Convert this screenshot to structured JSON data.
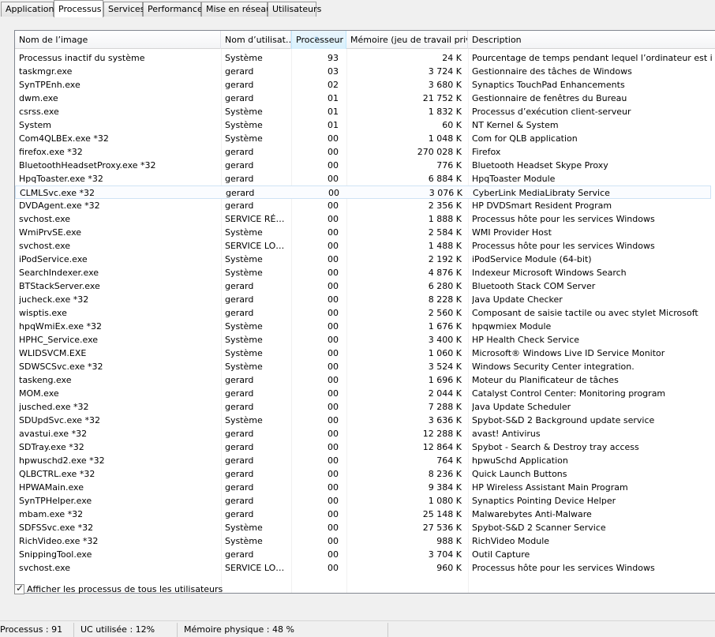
{
  "tabs": [
    "Applications",
    "Processus",
    "Services",
    "Performance",
    "Mise en réseau",
    "Utilisateurs"
  ],
  "active_tab": "Processus",
  "columns": [
    "Nom de l’image",
    "Nom d’utilisat…",
    "Processeur",
    "Mémoire (jeu de travail privé)",
    "Description"
  ],
  "sorted_column": "Processeur",
  "processes": [
    [
      "Processus inactif du système",
      "Système",
      "93",
      "24 K",
      "Pourcentage de temps pendant lequel l’ordinateur est inactif"
    ],
    [
      "taskmgr.exe",
      "gerard",
      "03",
      "3 724 K",
      "Gestionnaire des tâches de Windows"
    ],
    [
      "SynTPEnh.exe",
      "gerard",
      "02",
      "3 680 K",
      "Synaptics TouchPad Enhancements"
    ],
    [
      "dwm.exe",
      "gerard",
      "01",
      "21 752 K",
      "Gestionnaire de fenêtres du Bureau"
    ],
    [
      "csrss.exe",
      "Système",
      "01",
      "1 832 K",
      "Processus d’exécution client-serveur"
    ],
    [
      "System",
      "Système",
      "01",
      "60 K",
      "NT Kernel & System"
    ],
    [
      "Com4QLBEx.exe *32",
      "Système",
      "00",
      "1 048 K",
      "Com for QLB application"
    ],
    [
      "firefox.exe *32",
      "gerard",
      "00",
      "270 028 K",
      "Firefox"
    ],
    [
      "BluetoothHeadsetProxy.exe *32",
      "gerard",
      "00",
      "776 K",
      "Bluetooth Headset Skype Proxy"
    ],
    [
      "HpqToaster.exe *32",
      "gerard",
      "00",
      "6 884 K",
      "HpqToaster Module"
    ],
    [
      "CLMLSvc.exe *32",
      "gerard",
      "00",
      "3 076 K",
      "CyberLink MediaLibraty Service"
    ],
    [
      "DVDAgent.exe *32",
      "gerard",
      "00",
      "2 356 K",
      "HP DVDSmart Resident Program"
    ],
    [
      "svchost.exe",
      "SERVICE RÉ…",
      "00",
      "1 888 K",
      "Processus hôte pour les services Windows"
    ],
    [
      "WmiPrvSE.exe",
      "Système",
      "00",
      "2 584 K",
      "WMI Provider Host"
    ],
    [
      "svchost.exe",
      "SERVICE LO…",
      "00",
      "1 488 K",
      "Processus hôte pour les services Windows"
    ],
    [
      "iPodService.exe",
      "Système",
      "00",
      "2 192 K",
      "iPodService Module (64-bit)"
    ],
    [
      "SearchIndexer.exe",
      "Système",
      "00",
      "4 876 K",
      "Indexeur Microsoft Windows Search"
    ],
    [
      "BTStackServer.exe",
      "gerard",
      "00",
      "6 280 K",
      "Bluetooth Stack COM Server"
    ],
    [
      "jucheck.exe *32",
      "gerard",
      "00",
      "8 228 K",
      "Java Update Checker"
    ],
    [
      "wisptis.exe",
      "gerard",
      "00",
      "2 560 K",
      "Composant de saisie tactile ou avec stylet Microsoft"
    ],
    [
      "hpqWmiEx.exe *32",
      "Système",
      "00",
      "1 676 K",
      "hpqwmiex Module"
    ],
    [
      "HPHC_Service.exe",
      "Système",
      "00",
      "3 400 K",
      "HP Health Check Service"
    ],
    [
      "WLIDSVCM.EXE",
      "Système",
      "00",
      "1 060 K",
      "Microsoft® Windows Live ID Service Monitor"
    ],
    [
      "SDWSCSvc.exe *32",
      "Système",
      "00",
      "3 524 K",
      "Windows Security Center integration."
    ],
    [
      "taskeng.exe",
      "gerard",
      "00",
      "1 696 K",
      "Moteur du Planificateur de tâches"
    ],
    [
      "MOM.exe",
      "gerard",
      "00",
      "2 044 K",
      "Catalyst Control Center: Monitoring program"
    ],
    [
      "jusched.exe *32",
      "gerard",
      "00",
      "7 288 K",
      "Java Update Scheduler"
    ],
    [
      "SDUpdSvc.exe *32",
      "Système",
      "00",
      "3 636 K",
      "Spybot-S&D 2 Background update service"
    ],
    [
      "avastui.exe *32",
      "gerard",
      "00",
      "12 288 K",
      "avast! Antivirus"
    ],
    [
      "SDTray.exe *32",
      "gerard",
      "00",
      "12 864 K",
      "Spybot - Search & Destroy tray access"
    ],
    [
      "hpwuschd2.exe *32",
      "gerard",
      "00",
      "764 K",
      "hpwuSchd Application"
    ],
    [
      "QLBCTRL.exe *32",
      "gerard",
      "00",
      "8 236 K",
      "Quick Launch Buttons"
    ],
    [
      "HPWAMain.exe",
      "gerard",
      "00",
      "9 384 K",
      "HP Wireless Assistant Main Program"
    ],
    [
      "SynTPHelper.exe",
      "gerard",
      "00",
      "1 080 K",
      "Synaptics Pointing Device Helper"
    ],
    [
      "mbam.exe *32",
      "gerard",
      "00",
      "25 148 K",
      "Malwarebytes Anti-Malware"
    ],
    [
      "SDFSSvc.exe *32",
      "Système",
      "00",
      "27 536 K",
      "Spybot-S&D 2 Scanner Service"
    ],
    [
      "RichVideo.exe *32",
      "Système",
      "00",
      "988 K",
      "RichVideo Module"
    ],
    [
      "SnippingTool.exe",
      "gerard",
      "00",
      "3 704 K",
      "Outil Capture"
    ],
    [
      "svchost.exe",
      "SERVICE LO…",
      "00",
      "960 K",
      "Processus hôte pour les services Windows"
    ]
  ],
  "highlighted_process": "CLMLSvc.exe *32",
  "show_all_users_label": "Afficher les processus de tous les utilisateurs",
  "show_all_users_checked": true,
  "status": {
    "processes": "Processus : 91",
    "cpu": "UC utilisée : 12%",
    "memory": "Mémoire physique : 48 %"
  }
}
